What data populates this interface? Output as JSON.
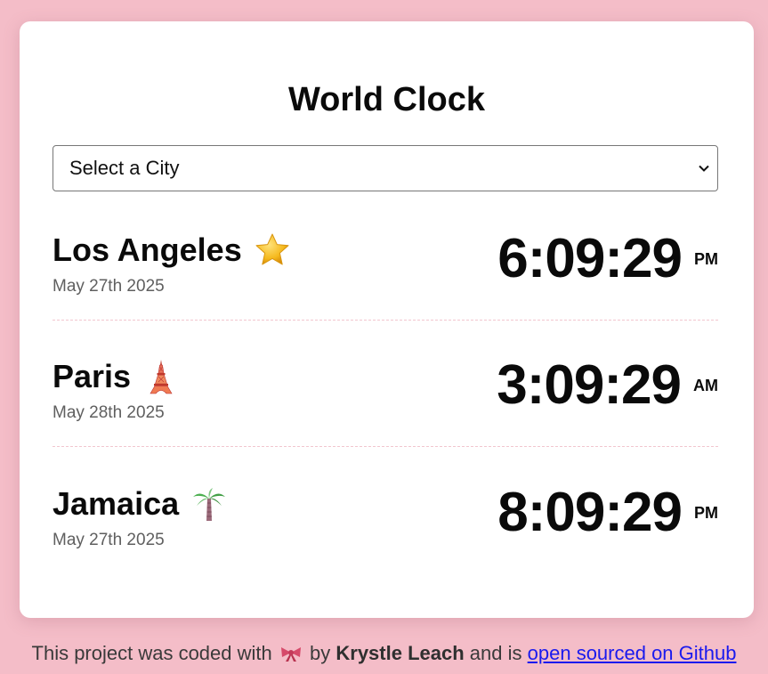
{
  "title": "World Clock",
  "select": {
    "value": "Select a City"
  },
  "cities": [
    {
      "name": "Los Angeles",
      "icon": "star-icon",
      "date": "May 27th 2025",
      "time": "6:09:29",
      "ampm": "PM"
    },
    {
      "name": "Paris",
      "icon": "eiffel-tower-icon",
      "date": "May 28th 2025",
      "time": "3:09:29",
      "ampm": "AM"
    },
    {
      "name": "Jamaica",
      "icon": "palm-tree-icon",
      "date": "May 27th 2025",
      "time": "8:09:29",
      "ampm": "PM"
    }
  ],
  "footer": {
    "prefix": "This project was coded with",
    "icon": "ribbon-bow-icon",
    "by": "by",
    "author": "Krystle Leach",
    "middle": "and is",
    "link": "open sourced on Github"
  },
  "colors": {
    "background": "#f4bdc8",
    "card": "#ffffff",
    "link": "#1a1aee"
  }
}
